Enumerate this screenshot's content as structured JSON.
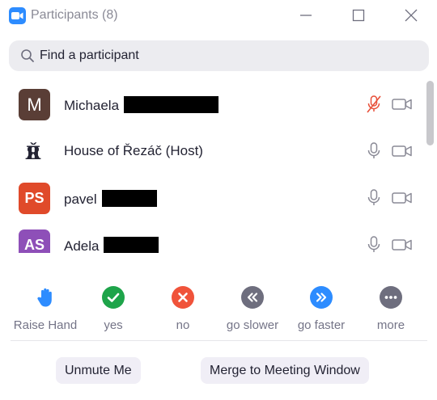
{
  "window": {
    "title": "Participants",
    "count": "(8)",
    "controls": [
      "minimize",
      "maximize",
      "close"
    ]
  },
  "search": {
    "placeholder": "Find a participant",
    "value": ""
  },
  "participants": [
    {
      "name": "Michaela",
      "avatar_text": "M",
      "avatar_color": "#5a3e36",
      "avatar_kind": "letter",
      "mic": "muted",
      "video": "off",
      "name_redacted": true
    },
    {
      "name": "House of Řezáč (Host)",
      "avatar_text": "ŘR",
      "avatar_kind": "logo",
      "mic": "on",
      "video": "off",
      "name_redacted": false
    },
    {
      "name": "pavel",
      "avatar_text": "PS",
      "avatar_color": "#e04a2a",
      "avatar_kind": "initials",
      "mic": "on",
      "video": "off",
      "name_redacted": true
    },
    {
      "name": "Adela",
      "avatar_text": "AS",
      "avatar_color": "#8e4fb8",
      "avatar_kind": "initials",
      "mic": "on",
      "video": "off",
      "name_redacted": true
    }
  ],
  "reactions": [
    {
      "label": "Raise Hand",
      "icon": "raise-hand-icon",
      "color": "#2D8CFF"
    },
    {
      "label": "yes",
      "icon": "check-icon",
      "color": "#1ea44a"
    },
    {
      "label": "no",
      "icon": "x-icon",
      "color": "#f0533a"
    },
    {
      "label": "go slower",
      "icon": "rewind-icon",
      "color": "#6e6e7e"
    },
    {
      "label": "go faster",
      "icon": "fast-forward-icon",
      "color": "#2D8CFF"
    },
    {
      "label": "more",
      "icon": "more-icon",
      "color": "#6e6e7e"
    }
  ],
  "buttons": {
    "unmute": "Unmute Me",
    "merge": "Merge to Meeting Window"
  },
  "colors": {
    "accent": "#2D8CFF",
    "muted_red": "#e8503a",
    "icon_gray": "#8a8a96"
  }
}
